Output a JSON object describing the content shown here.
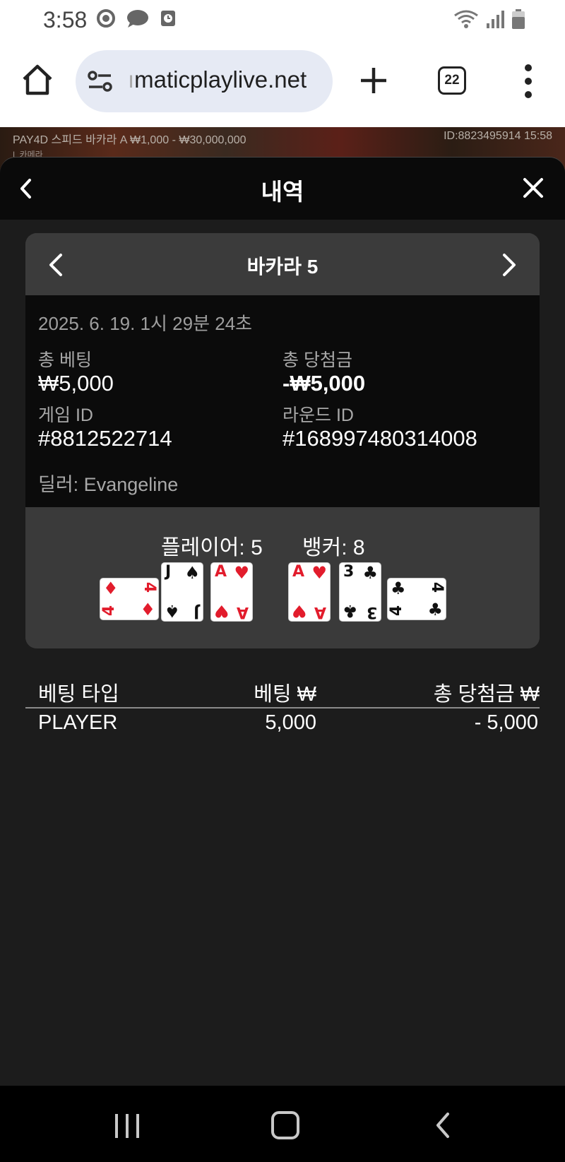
{
  "status_bar": {
    "time": "3:58",
    "icons": [
      "sync-icon",
      "messenger-icon",
      "clock-icon"
    ],
    "right_icons": [
      "wifi-icon",
      "signal-icon",
      "battery-icon"
    ]
  },
  "browser": {
    "url_fade": "ı",
    "url": "maticplaylive.net",
    "tab_count": "22"
  },
  "background_game": {
    "table_name": "PAY4D 스피드 바카라 A  ₩1,000 - ₩30,000,000",
    "id_time": "ID:8823495914   15:58",
    "sub": "L 카메라"
  },
  "panel": {
    "title": "내역"
  },
  "round": {
    "game_title": "바카라 5",
    "datetime": "2025. 6. 19. 1시 29분 24초",
    "total_bet_label": "총 베팅",
    "total_bet_value": "₩5,000",
    "total_win_label": "총 당첨금",
    "total_win_value": "-₩5,000",
    "game_id_label": "게임 ID",
    "game_id_value": "#8812522714",
    "round_id_label": "라운드 ID",
    "round_id_value": "#168997480314008",
    "dealer": "딜러: Evangeline"
  },
  "hands": {
    "player_label": "플레이어: 5",
    "banker_label": "뱅커: 8",
    "player_cards": [
      {
        "rank": "4",
        "suit": "♦",
        "color": "#e21c2c",
        "sideways": true
      },
      {
        "rank": "J",
        "suit": "♠",
        "color": "#111111",
        "sideways": false
      },
      {
        "rank": "A",
        "suit": "♥",
        "color": "#e21c2c",
        "sideways": false
      }
    ],
    "banker_cards": [
      {
        "rank": "A",
        "suit": "♥",
        "color": "#e21c2c",
        "sideways": false
      },
      {
        "rank": "3",
        "suit": "♣",
        "color": "#111111",
        "sideways": false
      },
      {
        "rank": "4",
        "suit": "♣",
        "color": "#111111",
        "sideways": true
      }
    ]
  },
  "bet_table": {
    "headers": [
      "베팅 타입",
      "베팅 ₩",
      "총 당첨금 ₩"
    ],
    "rows": [
      {
        "type": "PLAYER",
        "bet": "5,000",
        "win": "- 5,000"
      }
    ]
  },
  "colors": {
    "panel_bg": "#1c1c1c",
    "header_bg": "#0a0a0a",
    "card_red": "#e21c2c"
  }
}
